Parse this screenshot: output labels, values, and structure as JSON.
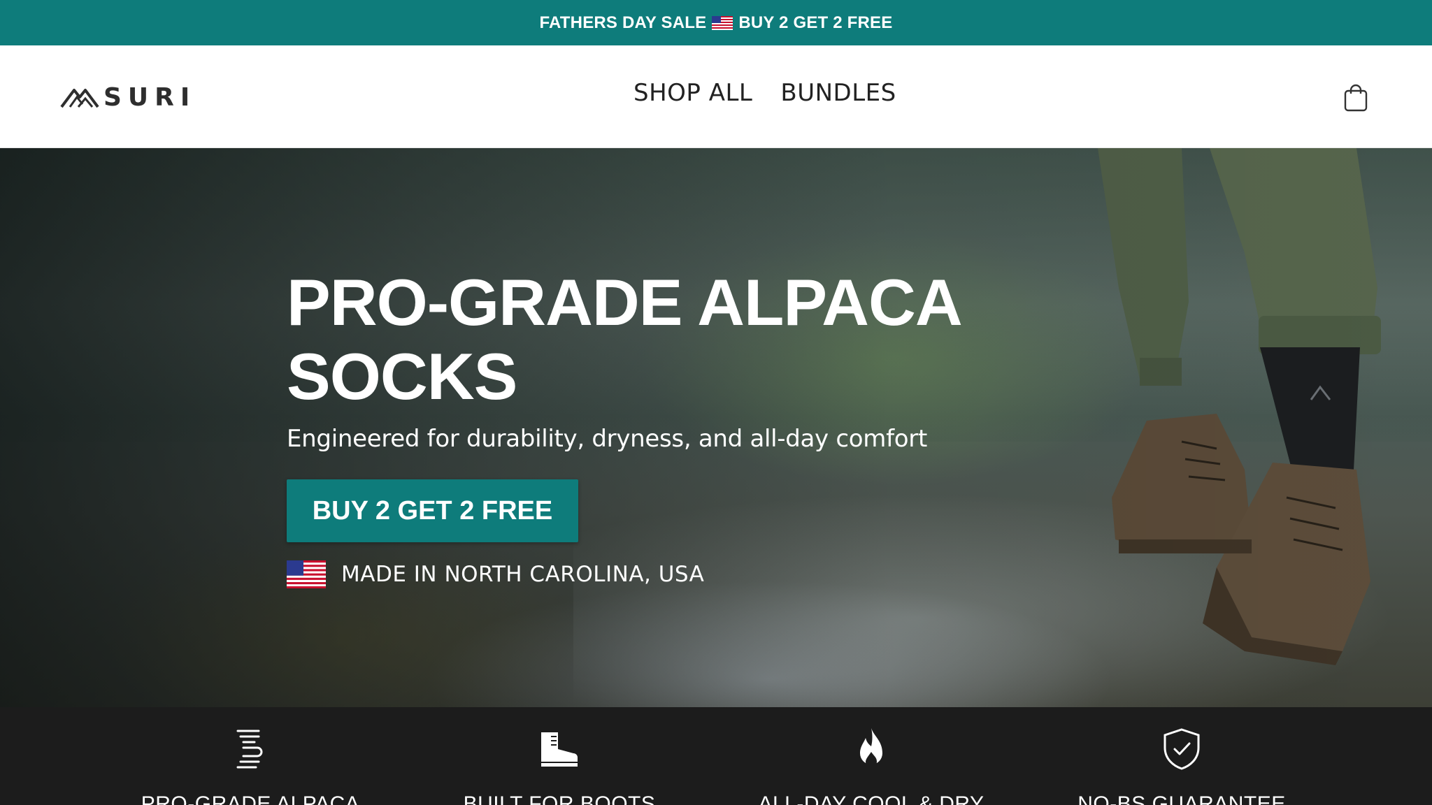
{
  "announcement": {
    "before_flag": "FATHERS DAY SALE",
    "after_flag": "BUY 2 GET 2 FREE",
    "flag_icon": "us-flag-icon"
  },
  "header": {
    "brand": "SURI",
    "nav": [
      {
        "label": "SHOP ALL"
      },
      {
        "label": "BUNDLES"
      }
    ],
    "cart_icon": "shopping-bag-icon"
  },
  "hero": {
    "title_line1": "PRO-GRADE ALPACA",
    "title_line2": "SOCKS",
    "subtitle": "Engineered for durability, dryness, and all-day comfort",
    "cta": "BUY 2 GET 2 FREE",
    "made_in": "MADE IN NORTH CAROLINA, USA"
  },
  "features": [
    {
      "label": "PRO-GRADE ALPACA",
      "icon": "alpaca-fiber-icon"
    },
    {
      "label": "BUILT FOR BOOTS",
      "icon": "boot-icon"
    },
    {
      "label": "ALL-DAY COOL & DRY",
      "icon": "flame-icon"
    },
    {
      "label": "NO-BS GUARANTEE",
      "icon": "shield-check-icon"
    }
  ],
  "colors": {
    "accent": "#0e7c7b",
    "feature_bar": "#1c1c1c"
  }
}
